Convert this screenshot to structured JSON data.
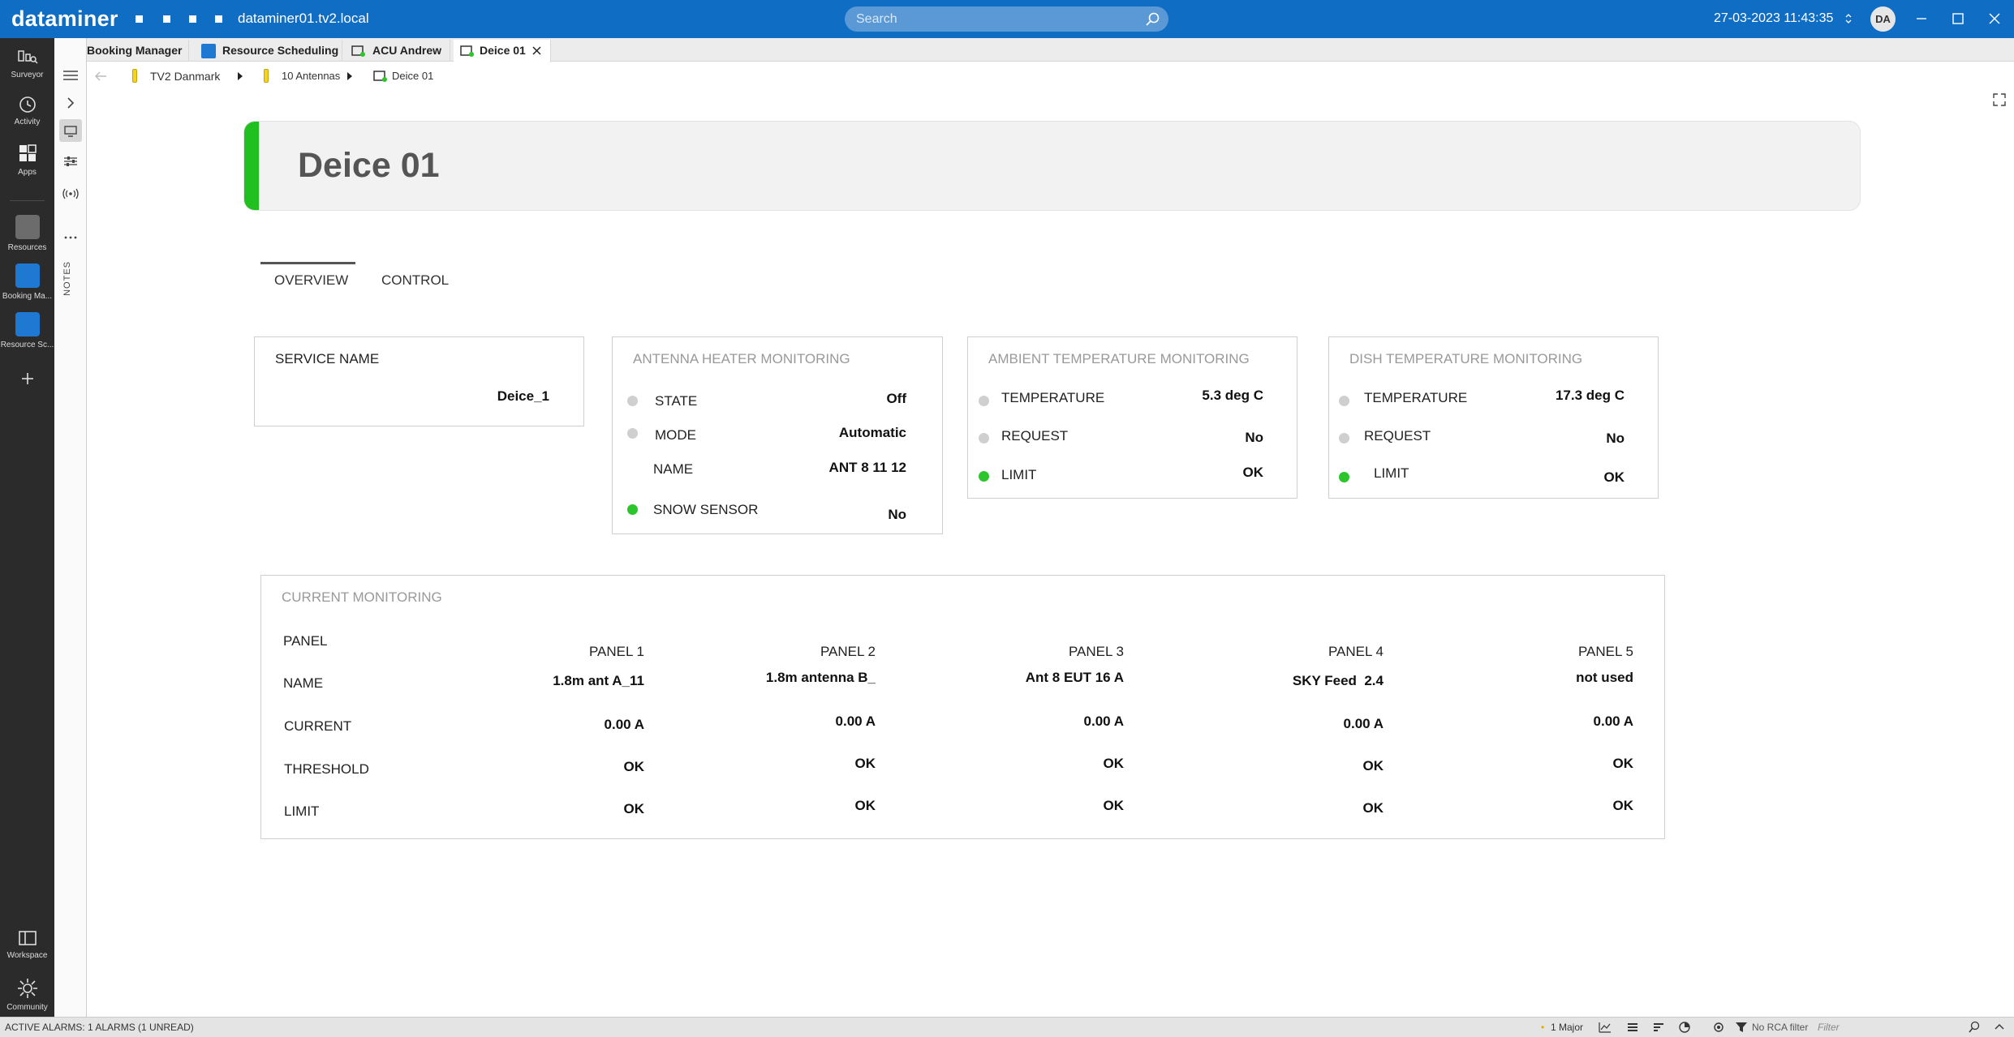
{
  "titlebar": {
    "brand": "dataminer",
    "host": "dataminer01.tv2.local",
    "search_placeholder": "Search",
    "datetime": "27-03-2023 11:43:35",
    "user_initials": "DA"
  },
  "rail": {
    "items": [
      {
        "label": "Surveyor"
      },
      {
        "label": "Activity"
      },
      {
        "label": "Apps"
      },
      {
        "label": "Resources"
      },
      {
        "label": "Booking Ma..."
      },
      {
        "label": "Resource Sc..."
      }
    ],
    "bottom": [
      {
        "label": "Workspace"
      },
      {
        "label": "Community"
      }
    ]
  },
  "strip": {
    "notes_label": "NOTES"
  },
  "tabs": [
    {
      "label": "Booking Manager"
    },
    {
      "label": "Resource Scheduling"
    },
    {
      "label": "ACU Andrew"
    },
    {
      "label": "Deice 01"
    }
  ],
  "breadcrumb": [
    "TV2 Danmark",
    "10 Antennas",
    "Deice 01"
  ],
  "page": {
    "title": "Deice 01",
    "accent_color": "#20c020",
    "view_tabs": [
      "OVERVIEW",
      "CONTROL"
    ]
  },
  "service": {
    "title": "SERVICE NAME",
    "value": "Deice_1"
  },
  "heater": {
    "title": "ANTENNA HEATER MONITORING",
    "rows": [
      {
        "label": "STATE",
        "value": "Off",
        "led": "gray"
      },
      {
        "label": "MODE",
        "value": "Automatic",
        "led": "gray"
      },
      {
        "label": "NAME",
        "value": "ANT 8 11 12",
        "led": "none"
      },
      {
        "label": "SNOW SENSOR",
        "value": "No",
        "led": "green"
      }
    ]
  },
  "ambient": {
    "title": "AMBIENT TEMPERATURE MONITORING",
    "rows": [
      {
        "label": "TEMPERATURE",
        "value": "5.3 deg C",
        "led": "gray"
      },
      {
        "label": "REQUEST",
        "value": "No",
        "led": "gray"
      },
      {
        "label": "LIMIT",
        "value": "OK",
        "led": "green"
      }
    ]
  },
  "dish": {
    "title": "DISH TEMPERATURE MONITORING",
    "rows": [
      {
        "label": "TEMPERATURE",
        "value": "17.3 deg C",
        "led": "gray"
      },
      {
        "label": "REQUEST",
        "value": "No",
        "led": "gray"
      },
      {
        "label": "LIMIT",
        "value": "OK",
        "led": "green"
      }
    ]
  },
  "current": {
    "title": "CURRENT MONITORING",
    "row_labels": [
      "PANEL",
      "NAME",
      "CURRENT",
      "THRESHOLD",
      "LIMIT"
    ],
    "panels": [
      {
        "panel": "PANEL 1",
        "name": "1.8m ant A_11",
        "current": "0.00 A",
        "threshold": "OK",
        "limit": "OK"
      },
      {
        "panel": "PANEL 2",
        "name": "1.8m antenna B_",
        "current": "0.00 A",
        "threshold": "OK",
        "limit": "OK"
      },
      {
        "panel": "PANEL 3",
        "name": "Ant 8 EUT 16 A",
        "current": "0.00 A",
        "threshold": "OK",
        "limit": "OK"
      },
      {
        "panel": "PANEL 4",
        "name": "SKY Feed  2.4",
        "current": "0.00 A",
        "threshold": "OK",
        "limit": "OK"
      },
      {
        "panel": "PANEL 5",
        "name": "not used",
        "current": "0.00 A",
        "threshold": "OK",
        "limit": "OK"
      }
    ]
  },
  "statusbar": {
    "alarms": "ACTIVE ALARMS: 1 ALARMS (1 UNREAD)",
    "major": "1 Major",
    "rca": "No RCA filter",
    "filter_placeholder": "Filter"
  }
}
